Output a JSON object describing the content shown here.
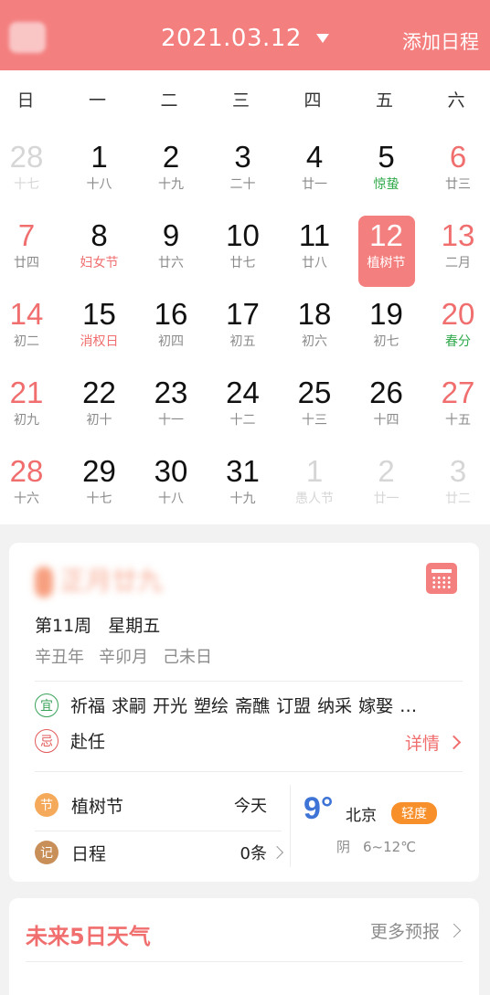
{
  "header": {
    "date": "2021.03.12",
    "add_schedule": "添加日程"
  },
  "weekdays": [
    "日",
    "一",
    "二",
    "三",
    "四",
    "五",
    "六"
  ],
  "days": [
    {
      "n": "28",
      "s": "十七",
      "t": "other"
    },
    {
      "n": "1",
      "s": "十八"
    },
    {
      "n": "2",
      "s": "十九"
    },
    {
      "n": "3",
      "s": "二十"
    },
    {
      "n": "4",
      "s": "廿一"
    },
    {
      "n": "5",
      "s": "惊蛰",
      "sc": "term"
    },
    {
      "n": "6",
      "s": "廿三",
      "t": "weekend"
    },
    {
      "n": "7",
      "s": "廿四",
      "t": "weekend"
    },
    {
      "n": "8",
      "s": "妇女节",
      "sc": "fest"
    },
    {
      "n": "9",
      "s": "廿六"
    },
    {
      "n": "10",
      "s": "廿七"
    },
    {
      "n": "11",
      "s": "廿八"
    },
    {
      "n": "12",
      "s": "植树节",
      "t": "selected"
    },
    {
      "n": "13",
      "s": "二月",
      "t": "weekend"
    },
    {
      "n": "14",
      "s": "初二",
      "t": "weekend"
    },
    {
      "n": "15",
      "s": "消权日",
      "sc": "fest"
    },
    {
      "n": "16",
      "s": "初四"
    },
    {
      "n": "17",
      "s": "初五"
    },
    {
      "n": "18",
      "s": "初六"
    },
    {
      "n": "19",
      "s": "初七"
    },
    {
      "n": "20",
      "s": "春分",
      "t": "weekend",
      "sc": "term"
    },
    {
      "n": "21",
      "s": "初九",
      "t": "weekend"
    },
    {
      "n": "22",
      "s": "初十"
    },
    {
      "n": "23",
      "s": "十一"
    },
    {
      "n": "24",
      "s": "十二"
    },
    {
      "n": "25",
      "s": "十三"
    },
    {
      "n": "26",
      "s": "十四"
    },
    {
      "n": "27",
      "s": "十五",
      "t": "weekend"
    },
    {
      "n": "28",
      "s": "十六",
      "t": "weekend"
    },
    {
      "n": "29",
      "s": "十七"
    },
    {
      "n": "30",
      "s": "十八"
    },
    {
      "n": "31",
      "s": "十九"
    },
    {
      "n": "1",
      "s": "愚人节",
      "t": "other"
    },
    {
      "n": "2",
      "s": "廿一",
      "t": "other"
    },
    {
      "n": "3",
      "s": "廿二",
      "t": "other"
    }
  ],
  "info": {
    "lunar_title": "正月廿九",
    "week": "第11周",
    "weekday": "星期五",
    "ganzhi": [
      "辛丑年",
      "辛卯月",
      "己未日"
    ],
    "yi_badge": "宜",
    "yi_items": [
      "祈福",
      "求嗣",
      "开光",
      "塑绘",
      "斋醮",
      "订盟",
      "纳采",
      "嫁娶",
      "…"
    ],
    "ji_badge": "忌",
    "ji_items": "赴任",
    "detail_label": "详情",
    "festival_badge": "节",
    "festival_label": "植树节",
    "festival_value": "今天",
    "schedule_badge": "记",
    "schedule_label": "日程",
    "schedule_value": "0条"
  },
  "weather": {
    "temp": "9°",
    "city": "北京",
    "aqi": "轻度",
    "condition": "阴",
    "range": "6~12℃"
  },
  "forecast": {
    "title": "未来5日天气",
    "more": "更多预报"
  },
  "colors": {
    "accent": "#f47f7f",
    "term_green": "#2fa94a",
    "temp_blue": "#3e74d6",
    "aqi_orange": "#f7902b"
  }
}
